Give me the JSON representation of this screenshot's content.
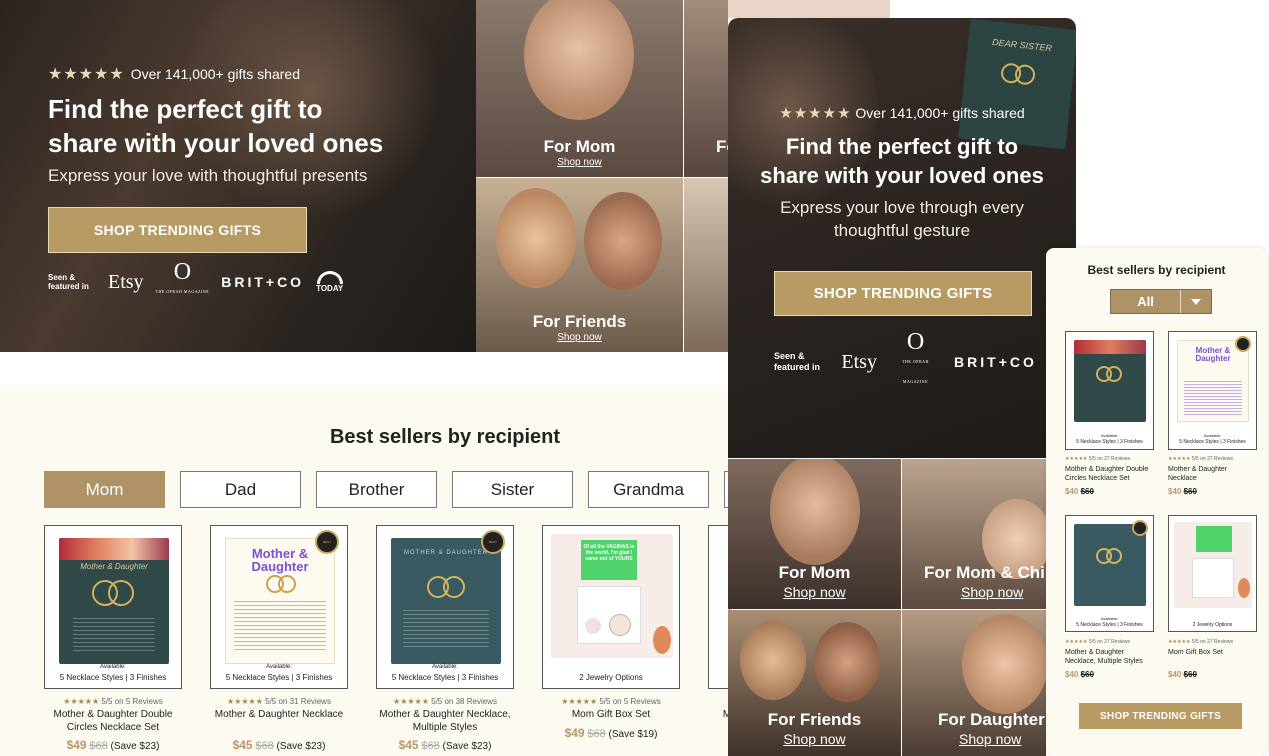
{
  "hero": {
    "stars": "★★★★★",
    "rating_text": "Over 141,000+ gifts shared",
    "title_line1": "Find the perfect gift to",
    "title_line2": "share with your loved ones",
    "subtitle": "Express your love with thoughtful presents",
    "cta": "SHOP TRENDING GIFTS",
    "seen_featured": "Seen & featured in",
    "logos": {
      "etsy": "Etsy",
      "oprah": "O",
      "oprah_small": "THE OPRAH MAGAZINE",
      "britco": "BRIT+CO",
      "today": "TODAY"
    }
  },
  "tiles": [
    {
      "label": "For Mom",
      "link": "Shop now"
    },
    {
      "label": "Fo",
      "link": ""
    },
    {
      "label": "For Friends",
      "link": "Shop now"
    }
  ],
  "section": {
    "title": "Best sellers by recipient",
    "tabs": [
      "Mom",
      "Dad",
      "Brother",
      "Sister",
      "Grandma"
    ],
    "active_tab": "Mom",
    "products": [
      {
        "available": "Available:",
        "options": "5 Necklace Styles | 3 Finishes",
        "stars": "★★★★★",
        "rating": "5/5 on 5 Reviews",
        "name": "Mother & Daughter Double Circles Necklace Set",
        "price": "$49",
        "was": "$68",
        "save": "(Save $23)",
        "box_title": "Mother & Daughter"
      },
      {
        "available": "Available:",
        "options": "5 Necklace Styles | 3 Finishes",
        "stars": "★★★★★",
        "rating": "5/5 on 31 Reviews",
        "name": "Mother & Daughter Necklace",
        "price": "$45",
        "was": "$68",
        "save": "(Save $23)",
        "box_title": "Mother & Daughter"
      },
      {
        "available": "Available:",
        "options": "5 Necklace Styles | 3 Finishes",
        "stars": "★★★★★",
        "rating": "5/5 on 38 Reviews",
        "name": "Mother & Daughter Necklace, Multiple Styles",
        "price": "$45",
        "was": "$68",
        "save": "(Save $23)",
        "box_title": "MOTHER & DAUGHTER"
      },
      {
        "available": "",
        "options": "2 Jewelry Options",
        "stars": "★★★★★",
        "rating": "5/5 on 5 Reviews",
        "name": "Mom Gift Box Set",
        "price": "$49",
        "was": "$68",
        "save": "(Save $19)",
        "box_title": "Of all the VAGINAS in the world, I'm glad I came out of YOURS"
      }
    ],
    "partial_name": "M"
  },
  "mobile_hero": {
    "stars": "★★★★★",
    "rating_text": "Over 141,000+ gifts shared",
    "title_line1": "Find the perfect gift to",
    "title_line2": "share with your loved ones",
    "subtitle_line1": "Express your love through every",
    "subtitle_line2": "thoughtful gesture",
    "cta": "SHOP TRENDING GIFTS",
    "seen": "Seen &",
    "featured": "featured in",
    "box_text": "DEAR SISTER"
  },
  "mobile_tiles": [
    {
      "label": "For Mom",
      "link": "Shop now"
    },
    {
      "label": "For Mom & Chil",
      "link": "Shop now"
    },
    {
      "label": "For Friends",
      "link": "Shop now"
    },
    {
      "label": "For Daughter",
      "link": "Shop now"
    }
  ],
  "panel": {
    "title": "Best sellers by recipient",
    "select_value": "All",
    "products": [
      {
        "available": "Available:",
        "options": "5 Necklace Styles | 3 Finishes",
        "stars": "★★★★★",
        "rating": "5/5 on 27 Reviews",
        "name": "Mother & Daughter Double Circles Necklace Set",
        "price": "$40",
        "was": "$60"
      },
      {
        "available": "Available:",
        "options": "5 Necklace Styles | 3 Finishes",
        "stars": "★★★★★",
        "rating": "5/5 on 27 Reviews",
        "name": "Mother & Daughter Necklace",
        "price": "$40",
        "was": "$60"
      },
      {
        "available": "Available:",
        "options": "5 Necklace Styles | 3 Finishes",
        "stars": "★★★★★",
        "rating": "5/5 on 27 Reviews",
        "name": "Mother & Daughter Necklace, Multiple Styles",
        "price": "$40",
        "was": "$60"
      },
      {
        "available": "",
        "options": "2 Jewelry Options",
        "stars": "★★★★★",
        "rating": "5/5 on 27 Reviews",
        "name": "Mom Gift Box Set",
        "price": "$40",
        "was": "$60"
      }
    ],
    "cta": "SHOP TRENDING GIFTS"
  },
  "colors": {
    "gold": "#b89a63",
    "tab_active": "#ae9366",
    "cream": "#fdfaf1",
    "price": "#b8976a"
  }
}
